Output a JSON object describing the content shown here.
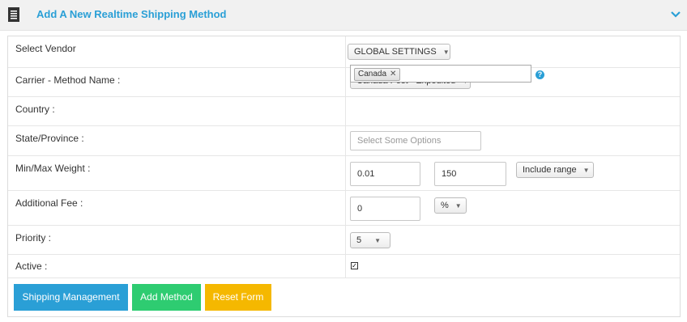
{
  "header": {
    "title": "Add A New Realtime Shipping Method",
    "icon": "document-icon",
    "toggle_icon": "chevron-down-icon"
  },
  "form": {
    "vendor": {
      "label": "Select Vendor",
      "value": "GLOBAL SETTINGS"
    },
    "carrier": {
      "label": "Carrier - Method Name :",
      "value": "Canada Post - Expedited"
    },
    "country": {
      "label": "Country :",
      "tag": "Canada",
      "help_icon": "help-icon"
    },
    "state": {
      "label": "State/Province :",
      "placeholder": "Select Some Options"
    },
    "weight": {
      "label": "Min/Max Weight :",
      "min": "0.01",
      "max": "150",
      "range_option": "Include range"
    },
    "fee": {
      "label": "Additional Fee :",
      "value": "0",
      "unit": "%"
    },
    "priority": {
      "label": "Priority :",
      "value": "5"
    },
    "active": {
      "label": "Active :",
      "checked": true
    }
  },
  "buttons": {
    "shipping_management": "Shipping Management",
    "add_method": "Add Method",
    "reset_form": "Reset Form"
  },
  "colors": {
    "accent": "#2a9fd6",
    "btn_blue": "#2a9fd6",
    "btn_green": "#2ecc71",
    "btn_yellow": "#f5b800"
  }
}
